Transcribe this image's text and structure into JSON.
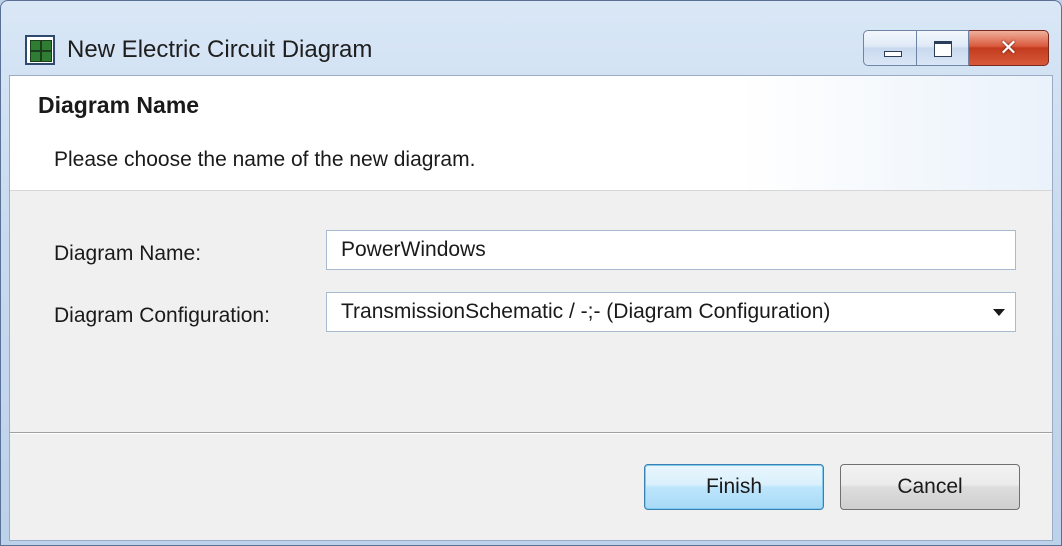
{
  "window": {
    "title": "New Electric Circuit Diagram",
    "icon": "diagram-grid-icon",
    "controls": {
      "minimize_icon": "minimize-icon",
      "maximize_icon": "maximize-icon",
      "close_icon": "close-icon",
      "close_glyph": "✕"
    }
  },
  "banner": {
    "title": "Diagram Name",
    "description": "Please choose the name of the new diagram."
  },
  "form": {
    "name_label": "Diagram Name:",
    "name_value": "PowerWindows",
    "config_label": "Diagram Configuration:",
    "config_value": "TransmissionSchematic / -;- (Diagram Configuration)"
  },
  "buttons": {
    "finish": "Finish",
    "cancel": "Cancel"
  },
  "colors": {
    "accent": "#3c7fb1",
    "close": "#c23b1e"
  }
}
